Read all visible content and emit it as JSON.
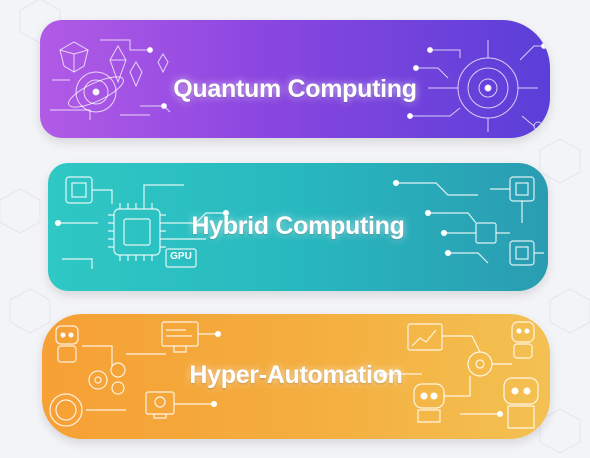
{
  "banners": [
    {
      "title": "Quantum Computing",
      "theme": "purple",
      "colors": [
        "#b15be6",
        "#5a3fd8"
      ]
    },
    {
      "title": "Hybrid Computing",
      "theme": "teal",
      "colors": [
        "#2fc8c4",
        "#2a9cb2"
      ],
      "chip_label": "GPU"
    },
    {
      "title": "Hyper-Automation",
      "theme": "orange",
      "colors": [
        "#f6a035",
        "#f3c152"
      ]
    }
  ],
  "icons": {
    "quantum": [
      "crystal-icon",
      "atom-swirl-icon",
      "quantum-circuit-icon"
    ],
    "hybrid": [
      "cpu-chip-icon",
      "gpu-chip-icon",
      "circuit-trace-icon"
    ],
    "automation": [
      "robot-icon",
      "gear-icon",
      "monitor-icon",
      "chart-icon"
    ]
  }
}
